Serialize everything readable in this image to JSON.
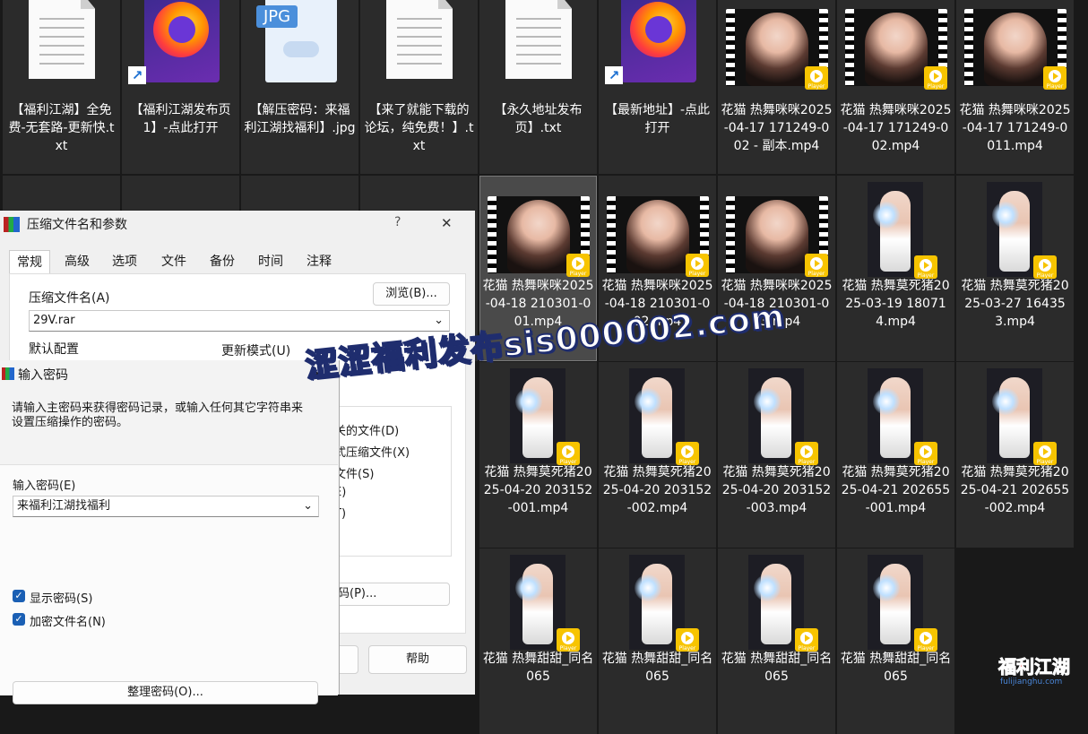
{
  "files": [
    {
      "label": "【福利江湖】全免费-无套路-更新快.txt",
      "kind": "txt"
    },
    {
      "label": "【福利江湖发布页1】-点此打开",
      "kind": "firefox"
    },
    {
      "label": "【解压密码：来福利江湖找福利】.jpg",
      "kind": "jpg",
      "tag": "JPG"
    },
    {
      "label": "【来了就能下载的论坛，纯免费！】.txt",
      "kind": "txt"
    },
    {
      "label": "【永久地址发布页】.txt",
      "kind": "txt"
    },
    {
      "label": "【最新地址】-点此打开",
      "kind": "firefox"
    },
    {
      "label": "花猫 热舞咪咪2025-04-17 171249-002 - 副本.mp4",
      "kind": "video"
    },
    {
      "label": "花猫 热舞咪咪2025-04-17 171249-002.mp4",
      "kind": "video"
    },
    {
      "label": "花猫 热舞咪咪2025-04-17 171249-0011.mp4",
      "kind": "video"
    },
    {
      "label": "花猫 热舞咪咪2025-04-18 210301-001.mp4",
      "kind": "video",
      "selected": true
    },
    {
      "label": "花猫 热舞咪咪2025-04-18 210301-002.mp4",
      "kind": "video"
    },
    {
      "label": "花猫 热舞咪咪2025-04-18 210301-003.mp4",
      "kind": "video"
    },
    {
      "label": "花猫 热舞莫死猪2025-03-19 180714.mp4",
      "kind": "tall"
    },
    {
      "label": "花猫 热舞莫死猪2025-03-27 164353.mp4",
      "kind": "tall"
    },
    {
      "label": "花猫 热舞莫死猪2025-04-20 203152-001.mp4",
      "kind": "tall"
    },
    {
      "label": "花猫 热舞莫死猪2025-04-20 203152-002.mp4",
      "kind": "tall"
    },
    {
      "label": "花猫 热舞莫死猪2025-04-20 203152-003.mp4",
      "kind": "tall"
    },
    {
      "label": "花猫 热舞莫死猪2025-04-21 202655-001.mp4",
      "kind": "tall"
    },
    {
      "label": "花猫 热舞莫死猪2025-04-21 202655-002.mp4",
      "kind": "tall"
    },
    {
      "label": "花猫 热舞甜甜_同名065",
      "kind": "tall"
    },
    {
      "label": "花猫 热舞甜甜_同名065",
      "kind": "tall"
    },
    {
      "label": "花猫 热舞甜甜_同名065",
      "kind": "tall"
    },
    {
      "label": "花猫 热舞甜甜_同名065",
      "kind": "tall"
    }
  ],
  "player_badge": "Player",
  "archive_dialog": {
    "title": "压缩文件名和参数",
    "help_glyph": "?",
    "close_glyph": "✕",
    "tabs": [
      "常规",
      "高级",
      "选项",
      "文件",
      "备份",
      "时间",
      "注释"
    ],
    "archive_name_label": "压缩文件名(A)",
    "browse_button": "浏览(B)...",
    "archive_name_value": "29V.rar",
    "default_profile_label": "默认配置",
    "update_mode_label": "更新模式(U)",
    "options_partial": [
      "关的文件(D)",
      "式压缩文件(X)",
      "文件(S)",
      "E)",
      "T)",
      ")"
    ],
    "password_button_partial": "码(P)...",
    "help_button": "帮助"
  },
  "password_dialog": {
    "title": "输入密码",
    "close_glyph": "✕",
    "description": "请输入主密码来获得密码记录，或输入任何其它字符串来设置压缩操作的密码。",
    "password_label": "输入密码(E)",
    "password_value": "来福利江湖找福利",
    "show_password": "显示密码(S)",
    "encrypt_names": "加密文件名(N)",
    "organize_button": "整理密码(O)..."
  },
  "watermark": "涩涩福利发布sis000002.com",
  "logo": {
    "text": "福利江湖",
    "url": "fulijianghu.com"
  }
}
